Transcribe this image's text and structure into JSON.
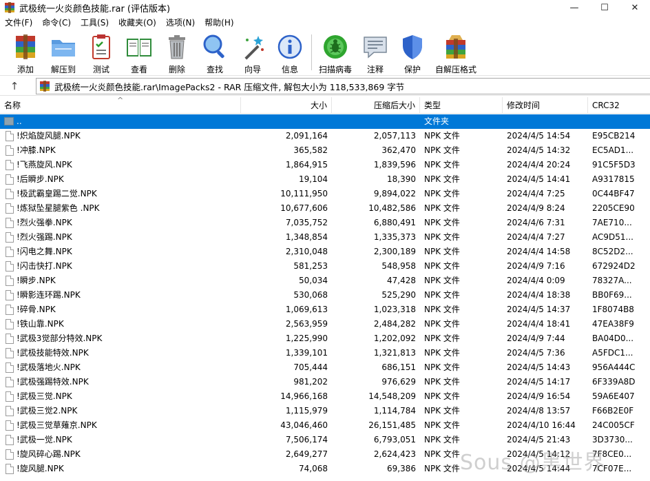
{
  "window": {
    "title": "武极统一火炎颜色技能.rar (评估版本)",
    "minimize": "—",
    "maximize": "☐",
    "close": "✕"
  },
  "menu": [
    "文件(F)",
    "命令(C)",
    "工具(S)",
    "收藏夹(O)",
    "选项(N)",
    "帮助(H)"
  ],
  "toolbar": [
    {
      "label": "添加",
      "icon": "add-archive-icon"
    },
    {
      "label": "解压到",
      "icon": "extract-folder-icon"
    },
    {
      "label": "测试",
      "icon": "test-clipboard-icon"
    },
    {
      "label": "查看",
      "icon": "view-book-icon"
    },
    {
      "label": "删除",
      "icon": "trash-bin-icon"
    },
    {
      "label": "查找",
      "icon": "magnifier-icon"
    },
    {
      "label": "向导",
      "icon": "wizard-wand-icon"
    },
    {
      "label": "信息",
      "icon": "info-icon"
    },
    {
      "label": "扫描病毒",
      "icon": "virus-scan-icon"
    },
    {
      "label": "注释",
      "icon": "comment-icon"
    },
    {
      "label": "保护",
      "icon": "shield-icon"
    },
    {
      "label": "自解压格式",
      "icon": "sfx-archive-icon"
    }
  ],
  "address": {
    "up_arrow": "↑",
    "path": "武极统一火炎颜色技能.rar\\ImagePacks2 - RAR 压缩文件, 解包大小为 118,533,869 字节"
  },
  "columns": {
    "name": "名称",
    "size": "大小",
    "packed": "压缩后大小",
    "type": "类型",
    "modified": "修改时间",
    "crc": "CRC32",
    "sort_indicator": "^"
  },
  "rows": [
    {
      "name": "..",
      "size": "",
      "packed": "",
      "type": "文件夹",
      "modified": "",
      "crc": "",
      "folder": true,
      "selected": true
    },
    {
      "name": "!炽焰旋风腿.NPK",
      "size": "2,091,164",
      "packed": "2,057,113",
      "type": "NPK 文件",
      "modified": "2024/4/5 14:54",
      "crc": "E95CB214"
    },
    {
      "name": "!冲膝.NPK",
      "size": "365,582",
      "packed": "362,470",
      "type": "NPK 文件",
      "modified": "2024/4/5 14:32",
      "crc": "EC5AD1..."
    },
    {
      "name": "!飞燕旋风.NPK",
      "size": "1,864,915",
      "packed": "1,839,596",
      "type": "NPK 文件",
      "modified": "2024/4/4 20:24",
      "crc": "91C5F5D3"
    },
    {
      "name": "!后瞬步.NPK",
      "size": "19,104",
      "packed": "18,390",
      "type": "NPK 文件",
      "modified": "2024/4/5 14:41",
      "crc": "A9317815"
    },
    {
      "name": "!极武霸皇踢二觉.NPK",
      "size": "10,111,950",
      "packed": "9,894,022",
      "type": "NPK 文件",
      "modified": "2024/4/4 7:25",
      "crc": "0C44BF47"
    },
    {
      "name": "!炼狱坠星腿紫色 .NPK",
      "size": "10,677,606",
      "packed": "10,482,586",
      "type": "NPK 文件",
      "modified": "2024/4/9 8:24",
      "crc": "2205CE90"
    },
    {
      "name": "!烈火强拳.NPK",
      "size": "7,035,752",
      "packed": "6,880,491",
      "type": "NPK 文件",
      "modified": "2024/4/6 7:31",
      "crc": "7AE710..."
    },
    {
      "name": "!烈火强踢.NPK",
      "size": "1,348,854",
      "packed": "1,335,373",
      "type": "NPK 文件",
      "modified": "2024/4/4 7:27",
      "crc": "AC9D51..."
    },
    {
      "name": "!闪电之舞.NPK",
      "size": "2,310,048",
      "packed": "2,300,189",
      "type": "NPK 文件",
      "modified": "2024/4/4 14:58",
      "crc": "8C52D2..."
    },
    {
      "name": "!闪击快打.NPK",
      "size": "581,253",
      "packed": "548,958",
      "type": "NPK 文件",
      "modified": "2024/4/9 7:16",
      "crc": "672924D2"
    },
    {
      "name": "!瞬步.NPK",
      "size": "50,034",
      "packed": "47,428",
      "type": "NPK 文件",
      "modified": "2024/4/4 0:09",
      "crc": "78327A..."
    },
    {
      "name": "!瞬影连环踢.NPK",
      "size": "530,068",
      "packed": "525,290",
      "type": "NPK 文件",
      "modified": "2024/4/4 18:38",
      "crc": "BB0F69..."
    },
    {
      "name": "!碎骨.NPK",
      "size": "1,069,613",
      "packed": "1,023,318",
      "type": "NPK 文件",
      "modified": "2024/4/5 14:37",
      "crc": "1F8074B8"
    },
    {
      "name": "!铁山靠.NPK",
      "size": "2,563,959",
      "packed": "2,484,282",
      "type": "NPK 文件",
      "modified": "2024/4/4 18:41",
      "crc": "47EA38F9"
    },
    {
      "name": "!武极3觉部分特效.NPK",
      "size": "1,225,990",
      "packed": "1,202,092",
      "type": "NPK 文件",
      "modified": "2024/4/9 7:44",
      "crc": "BA04D0..."
    },
    {
      "name": "!武极技能特效.NPK",
      "size": "1,339,101",
      "packed": "1,321,813",
      "type": "NPK 文件",
      "modified": "2024/4/5 7:36",
      "crc": "A5FDC1..."
    },
    {
      "name": "!武极落地火.NPK",
      "size": "705,444",
      "packed": "686,151",
      "type": "NPK 文件",
      "modified": "2024/4/5 14:43",
      "crc": "956A444C"
    },
    {
      "name": "!武极强踢特效.NPK",
      "size": "981,202",
      "packed": "976,629",
      "type": "NPK 文件",
      "modified": "2024/4/5 14:17",
      "crc": "6F339A8D"
    },
    {
      "name": "!武极三觉.NPK",
      "size": "14,966,168",
      "packed": "14,548,209",
      "type": "NPK 文件",
      "modified": "2024/4/9 16:54",
      "crc": "59A6E407"
    },
    {
      "name": "!武极三觉2.NPK",
      "size": "1,115,979",
      "packed": "1,114,784",
      "type": "NPK 文件",
      "modified": "2024/4/8 13:57",
      "crc": "F66B2E0F"
    },
    {
      "name": "!武极三觉草薙京.NPK",
      "size": "43,046,460",
      "packed": "26,151,485",
      "type": "NPK 文件",
      "modified": "2024/4/10 16:44",
      "crc": "24C005CF"
    },
    {
      "name": "!武极一觉.NPK",
      "size": "7,506,174",
      "packed": "6,793,051",
      "type": "NPK 文件",
      "modified": "2024/4/5 21:43",
      "crc": "3D3730..."
    },
    {
      "name": "!旋风碎心踢.NPK",
      "size": "2,649,277",
      "packed": "2,624,423",
      "type": "NPK 文件",
      "modified": "2024/4/5 14:12",
      "crc": "7F8CE0..."
    },
    {
      "name": "!旋风腿.NPK",
      "size": "74,068",
      "packed": "69,386",
      "type": "NPK 文件",
      "modified": "2024/4/5 14:44",
      "crc": "7CF07E..."
    }
  ],
  "watermark": "Sous @黑世界",
  "colors": {
    "selection": "#0078d7",
    "toolbar_separator": "#c8c8c8"
  }
}
